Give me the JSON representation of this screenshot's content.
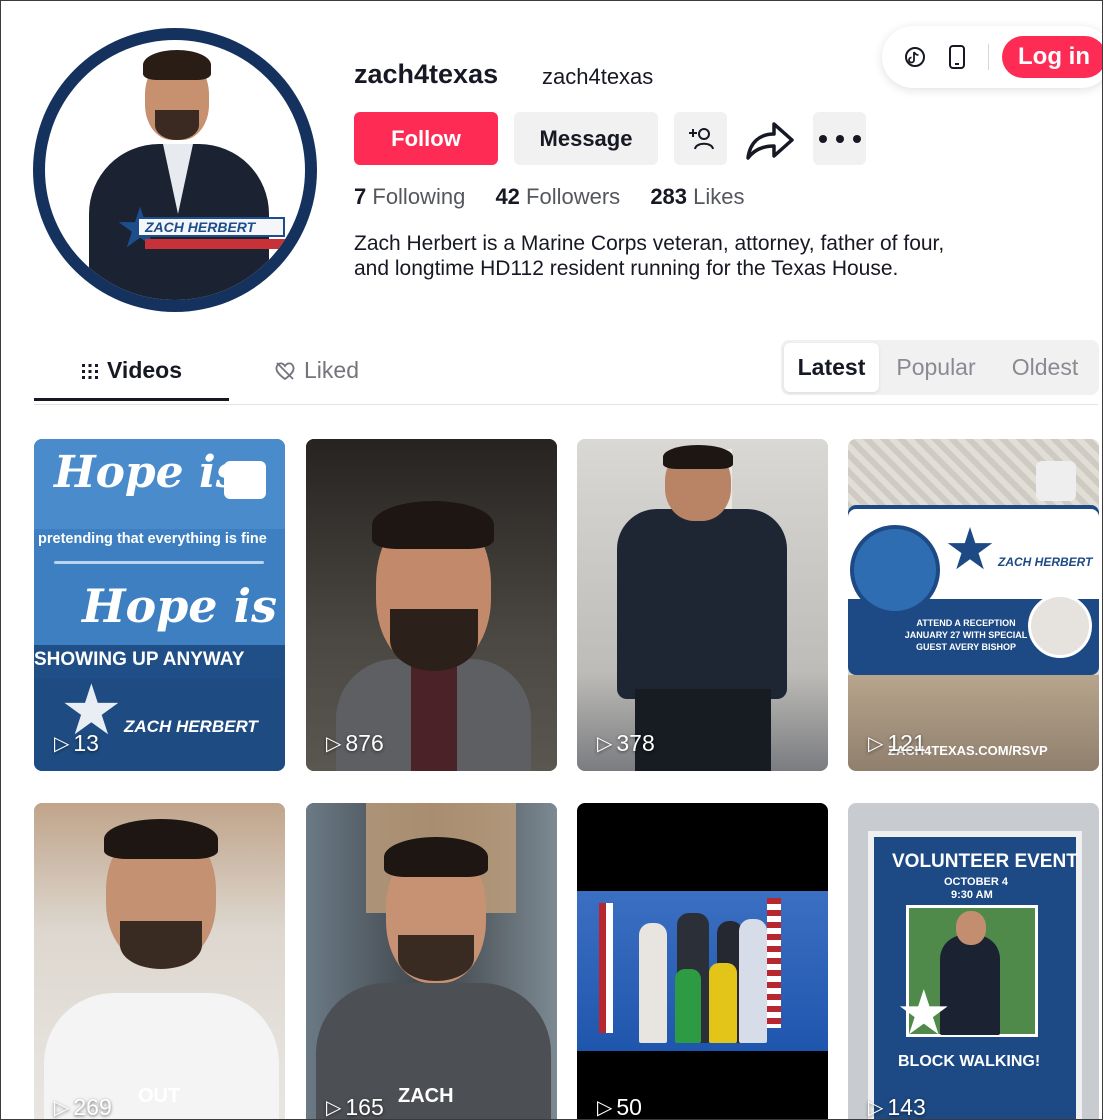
{
  "profile": {
    "username": "zach4texas",
    "nickname": "zach4texas",
    "avatar_logo_text": "ZACH HERBERT",
    "follow_label": "Follow",
    "message_label": "Message",
    "stats": {
      "following_count": "7",
      "following_label": "Following",
      "followers_count": "42",
      "followers_label": "Followers",
      "likes_count": "283",
      "likes_label": "Likes"
    },
    "bio_line1": "Zach Herbert is a Marine Corps veteran, attorney, father of four,",
    "bio_line2": "and longtime HD112 resident running for the Texas House."
  },
  "topbar": {
    "login_label": "Log in",
    "icons": [
      "tiktok-icon",
      "phone-icon"
    ]
  },
  "tabs": {
    "videos_label": "Videos",
    "liked_label": "Liked"
  },
  "sort": {
    "options": [
      "Latest",
      "Popular",
      "Oldest"
    ],
    "selected": "Latest"
  },
  "videos": [
    {
      "views": "13",
      "overlay": {
        "line1": "Hope is",
        "line2": "pretending that everything is fine",
        "line3": "Hope is",
        "line4": "SHOWING UP ANYWAY",
        "line5": "ZACH HERBERT"
      }
    },
    {
      "views": "876"
    },
    {
      "views": "378"
    },
    {
      "views": "121",
      "overlay": {
        "brand": "ZACH HERBERT",
        "event": "ATTEND A RECEPTION JANUARY 27 WITH SPECIAL GUEST AVERY BISHOP",
        "url": "ZACH4TEXAS.COM/RSVP"
      }
    },
    {
      "views": "269",
      "overlay": {
        "word": "OUT"
      }
    },
    {
      "views": "165",
      "overlay": {
        "word": "ZACH"
      }
    },
    {
      "views": "50"
    },
    {
      "views": "143",
      "overlay": {
        "title": "VOLUNTEER EVENT",
        "date": "OCTOBER 4",
        "time": "9:30 AM",
        "footer": "BLOCK WALKING!"
      }
    }
  ],
  "colors": {
    "accent": "#fe2c55",
    "text": "#161823",
    "muted": "#73757c",
    "button_bg": "#f1f1f2"
  }
}
